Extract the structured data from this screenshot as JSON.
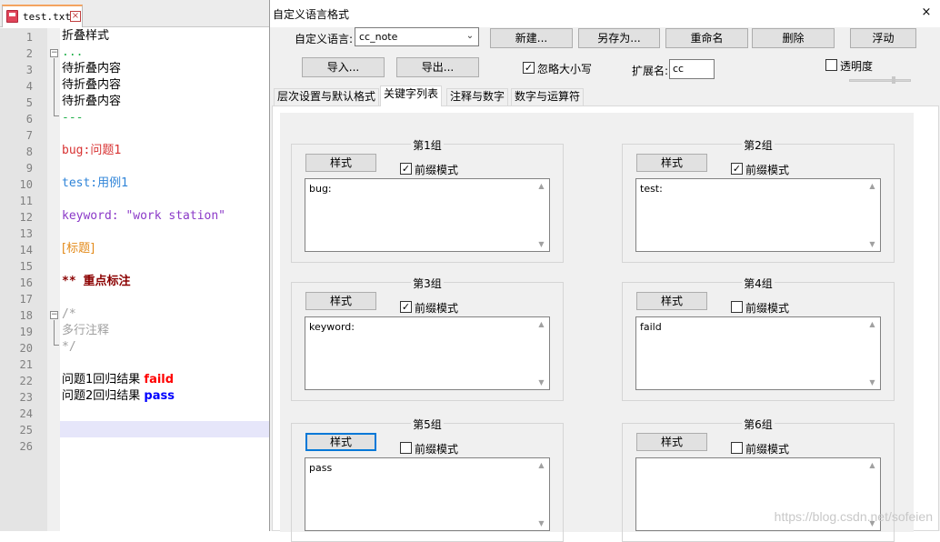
{
  "editor": {
    "tab_name": "test.txt",
    "tab_close": "×",
    "fold_open": "−",
    "lines": [
      {
        "n": "1",
        "text": "折叠样式"
      },
      {
        "n": "2",
        "text": "..."
      },
      {
        "n": "3",
        "text": "待折叠内容"
      },
      {
        "n": "4",
        "text": "待折叠内容"
      },
      {
        "n": "5",
        "text": "待折叠内容"
      },
      {
        "n": "6",
        "text": "---"
      },
      {
        "n": "7",
        "text": ""
      },
      {
        "n": "8",
        "text_a": "bug:",
        "text_b": "问题1"
      },
      {
        "n": "9",
        "text": ""
      },
      {
        "n": "10",
        "text_a": "test:",
        "text_b": "用例1"
      },
      {
        "n": "11",
        "text": ""
      },
      {
        "n": "12",
        "text": "keyword: \"work station\""
      },
      {
        "n": "13",
        "text": ""
      },
      {
        "n": "14",
        "text": "[标题]"
      },
      {
        "n": "15",
        "text": ""
      },
      {
        "n": "16",
        "text_a": "**",
        "text_b": "重点标注"
      },
      {
        "n": "17",
        "text": ""
      },
      {
        "n": "18",
        "text": "/*"
      },
      {
        "n": "19",
        "text": "多行注释"
      },
      {
        "n": "20",
        "text": "*/"
      },
      {
        "n": "21",
        "text": ""
      },
      {
        "n": "22",
        "text_a": "问题1回归结果",
        "text_b": "faild"
      },
      {
        "n": "23",
        "text_a": "问题2回归结果",
        "text_b": "pass"
      },
      {
        "n": "24",
        "text": ""
      },
      {
        "n": "25",
        "text": ""
      },
      {
        "n": "26",
        "text": ""
      }
    ]
  },
  "dialog": {
    "title": "自定义语言格式",
    "close": "×",
    "lang_label": "自定义语言:",
    "lang_value": "cc_note",
    "lang_arrow": "⌄",
    "buttons": {
      "new": "新建...",
      "save_as": "另存为...",
      "rename": "重命名",
      "delete": "删除",
      "float": "浮动",
      "import": "导入...",
      "export": "导出..."
    },
    "ignore_case": {
      "label": "忽略大小写",
      "checked": true
    },
    "ext_label": "扩展名:",
    "ext_value": "cc",
    "transparency": {
      "label": "透明度",
      "checked": false
    },
    "tabs": [
      "层次设置与默认格式",
      "关键字列表",
      "注释与数字",
      "数字与运算符"
    ],
    "active_tab": 1,
    "groups": [
      {
        "title": "第1组",
        "style_btn": "样式",
        "prefix_label": "前缀模式",
        "prefix_checked": "✓",
        "content": "bug:"
      },
      {
        "title": "第2组",
        "style_btn": "样式",
        "prefix_label": "前缀模式",
        "prefix_checked": "✓",
        "content": "test:"
      },
      {
        "title": "第3组",
        "style_btn": "样式",
        "prefix_label": "前缀模式",
        "prefix_checked": "✓",
        "content": "keyword:"
      },
      {
        "title": "第4组",
        "style_btn": "样式",
        "prefix_label": "前缀模式",
        "prefix_checked": "",
        "content": "faild"
      },
      {
        "title": "第5组",
        "style_btn": "样式",
        "prefix_label": "前缀模式",
        "prefix_checked": "",
        "content": "pass"
      },
      {
        "title": "第6组",
        "style_btn": "样式",
        "prefix_label": "前缀模式",
        "prefix_checked": "",
        "content": ""
      }
    ],
    "scroll_up": "▲",
    "scroll_down": "▼",
    "check_mark": "✓"
  },
  "watermark": "https://blog.csdn.net/sofeien"
}
